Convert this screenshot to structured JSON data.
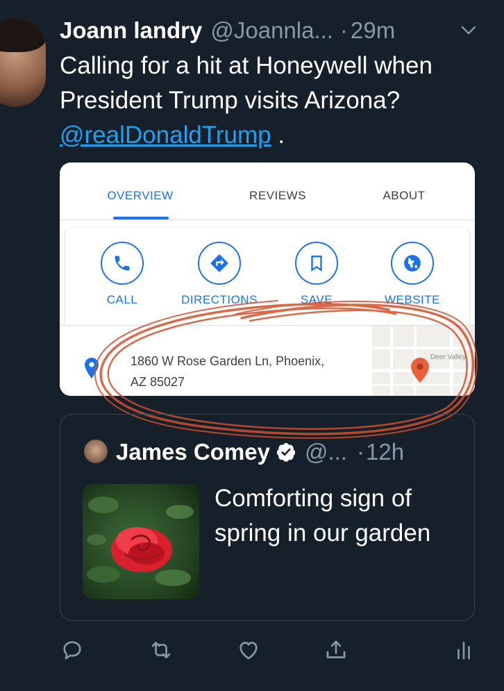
{
  "tweet": {
    "author_name": "Joann landry",
    "author_handle": "@Joannla...",
    "separator": "·",
    "time": "29m",
    "text_before": "Calling for a hit at Honeywell when President  Trump visits Arizona? ",
    "mention": "@realDonaldTrump",
    "text_after": " ."
  },
  "maps_card": {
    "tabs": [
      {
        "label": "OVERVIEW",
        "active": true
      },
      {
        "label": "REVIEWS",
        "active": false
      },
      {
        "label": "ABOUT",
        "active": false
      }
    ],
    "actions": [
      {
        "label": "CALL",
        "icon": "phone-icon"
      },
      {
        "label": "DIRECTIONS",
        "icon": "directions-icon"
      },
      {
        "label": "SAVE",
        "icon": "bookmark-icon"
      },
      {
        "label": "WEBSITE",
        "icon": "globe-icon"
      }
    ],
    "address_line1": "1860 W Rose Garden Ln, Phoenix,",
    "address_line2": "AZ 85027",
    "map_label": "Deer Valley",
    "accent_color": "#1a73e8",
    "scribble_color": "#d2502a"
  },
  "quoted_tweet": {
    "author_name": "James Comey",
    "author_handle": "@...",
    "separator": "·",
    "time": "12h",
    "text": "Comforting sign of spring in our garden"
  },
  "action_bar": {
    "icons": [
      "reply-icon",
      "retweet-icon",
      "like-icon",
      "share-icon",
      "analytics-icon"
    ]
  }
}
